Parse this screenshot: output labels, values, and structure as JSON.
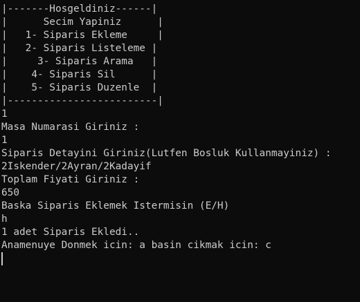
{
  "terminal": {
    "colors": {
      "background": "#0c0c0c",
      "foreground": "#cccccc"
    },
    "menu": {
      "border_top": "|-------Hosgeldiniz------|",
      "prompt": "|      Secim Yapiniz      |",
      "items": [
        "|   1- Siparis Ekleme     |",
        "|   2- Siparis Listeleme |",
        "|     3- Siparis Arama   |",
        "|    4- Siparis Sil      |",
        "|    5- Siparis Duzenle  |"
      ],
      "border_bottom": "|-------------------------|"
    },
    "session": [
      "1",
      "Masa Numarasi Giriniz :",
      "1",
      "Siparis Detayini Giriniz(Lutfen Bosluk Kullanmayiniz) :",
      "2Iskender/2Ayran/2Kadayif",
      "Toplam Fiyati Giriniz :",
      "650",
      "Baska Siparis Eklemek Istermisin (E/H)",
      "h",
      "1 adet Siparis Ekledi..",
      "Anamenuye Donmek icin: a basin cikmak icin: c"
    ]
  }
}
